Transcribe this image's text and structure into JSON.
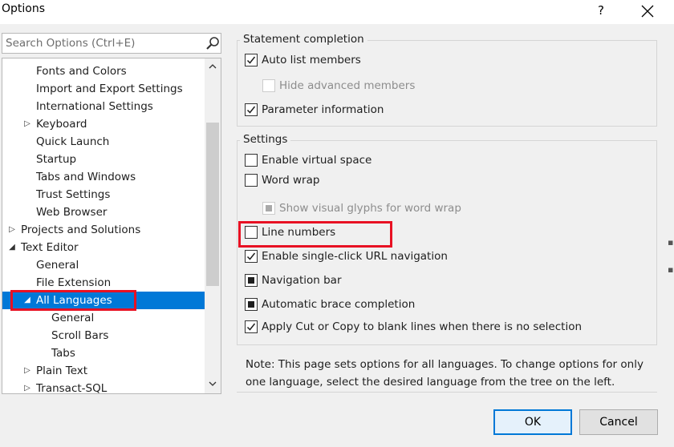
{
  "window": {
    "title": "Options",
    "help_glyph": "?"
  },
  "search": {
    "placeholder": "Search Options (Ctrl+E)",
    "icon": "search-icon"
  },
  "tree": {
    "items": [
      {
        "label": "Fonts and Colors",
        "level": 1,
        "expander": "none"
      },
      {
        "label": "Import and Export Settings",
        "level": 1,
        "expander": "none"
      },
      {
        "label": "International Settings",
        "level": 1,
        "expander": "none"
      },
      {
        "label": "Keyboard",
        "level": 1,
        "expander": "collapsed"
      },
      {
        "label": "Quick Launch",
        "level": 1,
        "expander": "none"
      },
      {
        "label": "Startup",
        "level": 1,
        "expander": "none"
      },
      {
        "label": "Tabs and Windows",
        "level": 1,
        "expander": "none"
      },
      {
        "label": "Trust Settings",
        "level": 1,
        "expander": "none"
      },
      {
        "label": "Web Browser",
        "level": 1,
        "expander": "none"
      },
      {
        "label": "Projects and Solutions",
        "level": 0,
        "expander": "collapsed"
      },
      {
        "label": "Text Editor",
        "level": 0,
        "expander": "expanded"
      },
      {
        "label": "General",
        "level": 1,
        "expander": "none"
      },
      {
        "label": "File Extension",
        "level": 1,
        "expander": "none"
      },
      {
        "label": "All Languages",
        "level": 1,
        "expander": "expanded",
        "selected": true
      },
      {
        "label": "General",
        "level": 2,
        "expander": "none"
      },
      {
        "label": "Scroll Bars",
        "level": 2,
        "expander": "none"
      },
      {
        "label": "Tabs",
        "level": 2,
        "expander": "none"
      },
      {
        "label": "Plain Text",
        "level": 1,
        "expander": "collapsed"
      },
      {
        "label": "Transact-SQL",
        "level": 1,
        "expander": "collapsed"
      }
    ]
  },
  "statement_completion": {
    "title": "Statement completion",
    "auto_list_members": {
      "label": "Auto list members",
      "state": "checked"
    },
    "hide_advanced_members": {
      "label": "Hide advanced members",
      "state": "unchecked",
      "disabled": true
    },
    "parameter_information": {
      "label": "Parameter information",
      "state": "checked"
    }
  },
  "settings": {
    "title": "Settings",
    "enable_virtual_space": {
      "label": "Enable virtual space",
      "state": "unchecked"
    },
    "word_wrap": {
      "label": "Word wrap",
      "state": "unchecked"
    },
    "show_visual_glyphs": {
      "label": "Show visual glyphs for word wrap",
      "state": "indeterminate",
      "disabled": true
    },
    "line_numbers": {
      "label": "Line numbers",
      "state": "unchecked"
    },
    "single_click_url": {
      "label": "Enable single-click URL navigation",
      "state": "checked"
    },
    "navigation_bar": {
      "label": "Navigation bar",
      "state": "indeterminate"
    },
    "automatic_brace": {
      "label": "Automatic brace completion",
      "state": "indeterminate"
    },
    "apply_cut_copy": {
      "label": "Apply Cut or Copy to blank lines when there is no selection",
      "state": "checked"
    }
  },
  "note": {
    "line1": "Note: This page sets options for all languages. To change options for only",
    "line2": "one language, select the desired language from the tree on the left."
  },
  "buttons": {
    "ok": "OK",
    "cancel": "Cancel"
  },
  "colors": {
    "selection": "#0078d7",
    "highlight_box": "#e81123",
    "window_bg": "#f0f0f0",
    "default_button_border": "#0078d7"
  }
}
